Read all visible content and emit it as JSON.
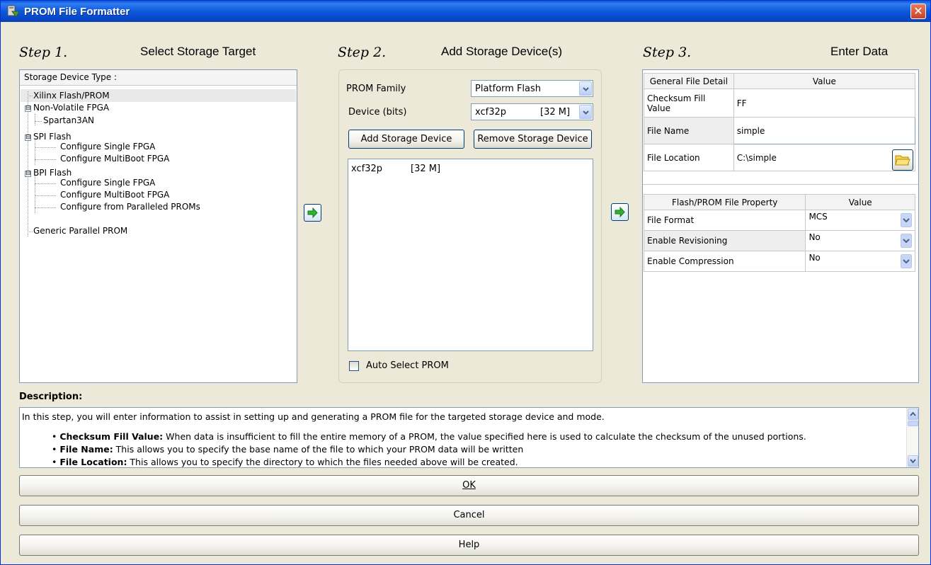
{
  "window": {
    "title": "PROM File Formatter",
    "close_glyph": "✕"
  },
  "step1": {
    "title": "Step 1.",
    "label": "Select Storage Target",
    "tree_header": "Storage Device Type :",
    "items": [
      "Xilinx Flash/PROM",
      "Non-Volatile FPGA",
      "Spartan3AN",
      "SPI Flash",
      "Configure Single FPGA",
      "Configure MultiBoot FPGA",
      "BPI Flash",
      "Configure Single FPGA",
      "Configure MultiBoot FPGA",
      "Configure from Paralleled PROMs",
      "Generic Parallel PROM"
    ],
    "expanders": [
      "⊟",
      "⊟",
      "⊟"
    ]
  },
  "step2": {
    "title": "Step 2.",
    "label": "Add Storage Device(s)",
    "prom_family_label": "PROM Family",
    "prom_family_value": "Platform Flash",
    "device_label": "Device (bits)",
    "device_value": "xcf32p",
    "device_size": "[32 M]",
    "add_button": "Add Storage Device",
    "remove_button": "Remove Storage Device",
    "list": [
      {
        "name": "xcf32p",
        "size": "[32 M]"
      }
    ],
    "auto_select_label": "Auto Select PROM",
    "auto_select_checked": false
  },
  "step3": {
    "title": "Step 3.",
    "label": "Enter Data",
    "file_detail_header": [
      "General File Detail",
      "Value"
    ],
    "file_details": [
      {
        "label": "Checksum Fill Value",
        "value": "FF"
      },
      {
        "label": "File Name",
        "value": "simple"
      },
      {
        "label": "File Location",
        "value": "C:\\simple"
      }
    ],
    "property_header": [
      "Flash/PROM File Property",
      "Value"
    ],
    "properties": [
      {
        "label": "File Format",
        "value": "MCS"
      },
      {
        "label": "Enable Revisioning",
        "value": "No"
      },
      {
        "label": "Enable Compression",
        "value": "No"
      }
    ]
  },
  "description": {
    "heading": "Description:",
    "intro": "In this step, you will enter information to assist in setting up and generating a PROM file for the targeted storage device and mode.",
    "bullets": [
      {
        "term": "Checksum Fill Value:",
        "text": " When data is insufficient to fill the entire memory of a PROM, the value specified here is used to calculate the checksum of the unused portions."
      },
      {
        "term": "File Name:",
        "text": " This allows you to specify the base name of the file to which your PROM data will be written"
      },
      {
        "term": "File Location:",
        "text": " This allows you to specify the directory to which the files needed above will be created."
      }
    ]
  },
  "buttons": {
    "ok": "OK",
    "cancel": "Cancel",
    "help": "Help"
  },
  "colors": {
    "titlebar": "#0c58dc",
    "background": "#ece9d8",
    "accent_arrow": "#2db32d"
  }
}
